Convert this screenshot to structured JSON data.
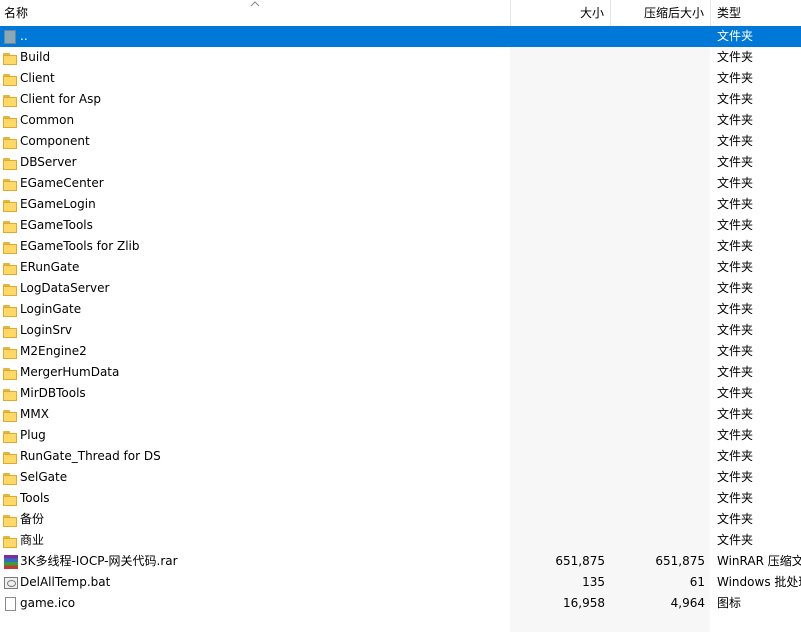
{
  "columns": {
    "name": "名称",
    "size": "大小",
    "packed": "压缩后大小",
    "type": "类型"
  },
  "rows": [
    {
      "name": "..",
      "size": "",
      "packed": "",
      "type": "文件夹",
      "icon": "parent-folder-icon",
      "selected": true
    },
    {
      "name": "Build",
      "size": "",
      "packed": "",
      "type": "文件夹",
      "icon": "folder-icon"
    },
    {
      "name": "Client",
      "size": "",
      "packed": "",
      "type": "文件夹",
      "icon": "folder-icon"
    },
    {
      "name": "Client for Asp",
      "size": "",
      "packed": "",
      "type": "文件夹",
      "icon": "folder-icon"
    },
    {
      "name": "Common",
      "size": "",
      "packed": "",
      "type": "文件夹",
      "icon": "folder-icon"
    },
    {
      "name": "Component",
      "size": "",
      "packed": "",
      "type": "文件夹",
      "icon": "folder-icon"
    },
    {
      "name": "DBServer",
      "size": "",
      "packed": "",
      "type": "文件夹",
      "icon": "folder-icon"
    },
    {
      "name": "EGameCenter",
      "size": "",
      "packed": "",
      "type": "文件夹",
      "icon": "folder-icon"
    },
    {
      "name": "EGameLogin",
      "size": "",
      "packed": "",
      "type": "文件夹",
      "icon": "folder-icon"
    },
    {
      "name": "EGameTools",
      "size": "",
      "packed": "",
      "type": "文件夹",
      "icon": "folder-icon"
    },
    {
      "name": "EGameTools for Zlib",
      "size": "",
      "packed": "",
      "type": "文件夹",
      "icon": "folder-icon"
    },
    {
      "name": "ERunGate",
      "size": "",
      "packed": "",
      "type": "文件夹",
      "icon": "folder-icon"
    },
    {
      "name": "LogDataServer",
      "size": "",
      "packed": "",
      "type": "文件夹",
      "icon": "folder-icon"
    },
    {
      "name": "LoginGate",
      "size": "",
      "packed": "",
      "type": "文件夹",
      "icon": "folder-icon"
    },
    {
      "name": "LoginSrv",
      "size": "",
      "packed": "",
      "type": "文件夹",
      "icon": "folder-icon"
    },
    {
      "name": "M2Engine2",
      "size": "",
      "packed": "",
      "type": "文件夹",
      "icon": "folder-icon"
    },
    {
      "name": "MergerHumData",
      "size": "",
      "packed": "",
      "type": "文件夹",
      "icon": "folder-icon"
    },
    {
      "name": "MirDBTools",
      "size": "",
      "packed": "",
      "type": "文件夹",
      "icon": "folder-icon"
    },
    {
      "name": "MMX",
      "size": "",
      "packed": "",
      "type": "文件夹",
      "icon": "folder-icon"
    },
    {
      "name": "Plug",
      "size": "",
      "packed": "",
      "type": "文件夹",
      "icon": "folder-icon"
    },
    {
      "name": "RunGate_Thread for DS",
      "size": "",
      "packed": "",
      "type": "文件夹",
      "icon": "folder-icon"
    },
    {
      "name": "SelGate",
      "size": "",
      "packed": "",
      "type": "文件夹",
      "icon": "folder-icon"
    },
    {
      "name": "Tools",
      "size": "",
      "packed": "",
      "type": "文件夹",
      "icon": "folder-icon"
    },
    {
      "name": "备份",
      "size": "",
      "packed": "",
      "type": "文件夹",
      "icon": "folder-icon"
    },
    {
      "name": "商业",
      "size": "",
      "packed": "",
      "type": "文件夹",
      "icon": "folder-icon"
    },
    {
      "name": "3K多线程-IOCP-网关代码.rar",
      "size": "651,875",
      "packed": "651,875",
      "type": "WinRAR 压缩文",
      "icon": "rar-archive-icon"
    },
    {
      "name": "DelAllTemp.bat",
      "size": "135",
      "packed": "61",
      "type": "Windows 批处理",
      "icon": "batch-file-icon"
    },
    {
      "name": "game.ico",
      "size": "16,958",
      "packed": "4,964",
      "type": "图标",
      "icon": "ico-file-icon"
    }
  ]
}
